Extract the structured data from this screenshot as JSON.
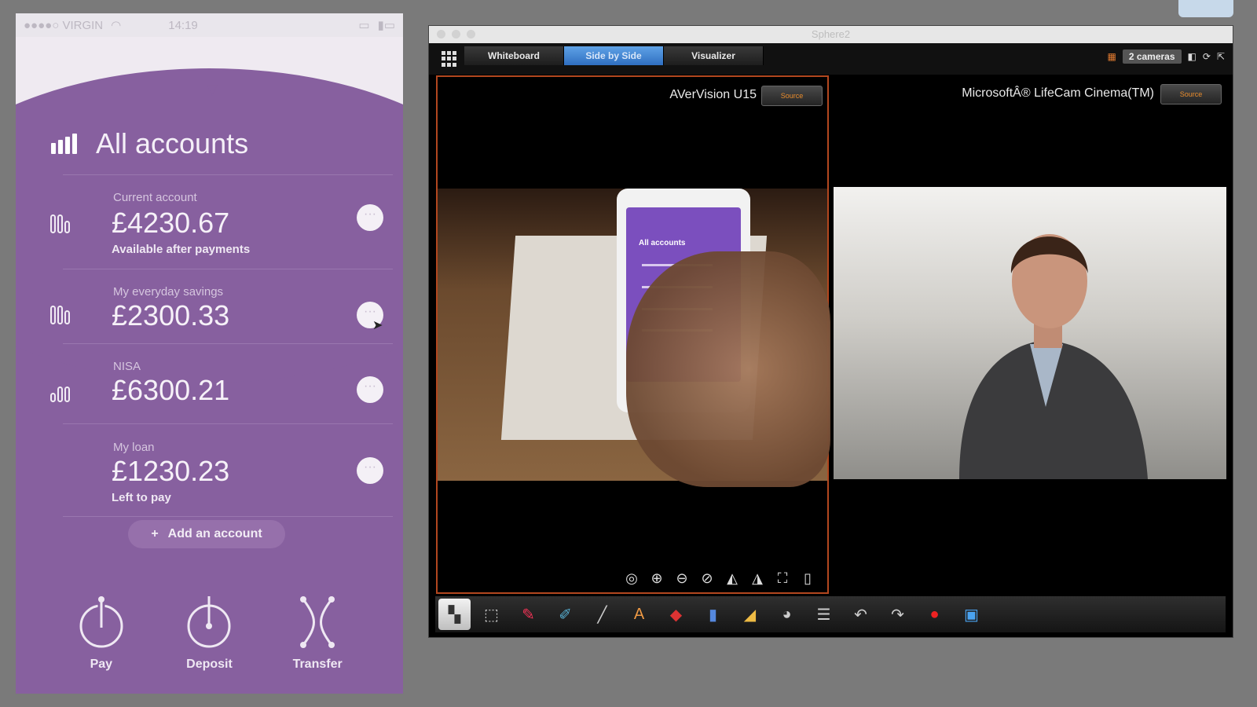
{
  "phone": {
    "status": {
      "carrier": "●●●●○ VIRGIN",
      "wifi": "wifi-icon",
      "time": "14:19"
    },
    "title": "All accounts",
    "accounts": [
      {
        "label": "Current account",
        "amount": "£4230.67",
        "note": "Available after payments"
      },
      {
        "label": "My everyday savings",
        "amount": "£2300.33",
        "note": ""
      },
      {
        "label": "NISA",
        "amount": "£6300.21",
        "note": ""
      },
      {
        "label": "My loan",
        "amount": "£1230.23",
        "note": "Left to pay"
      }
    ],
    "more": "···",
    "add_account": "Add an account",
    "add_plus": "+",
    "actions": [
      {
        "label": "Pay",
        "icon": "pay-icon"
      },
      {
        "label": "Deposit",
        "icon": "deposit-icon"
      },
      {
        "label": "Transfer",
        "icon": "transfer-icon"
      }
    ],
    "colors": {
      "primary": "#87609f",
      "header": "#efeaf1"
    }
  },
  "window": {
    "title": "Sphere2",
    "tabs": [
      "Whiteboard",
      "Side by Side",
      "Visualizer"
    ],
    "active_tab": "Side by Side",
    "cameras_label": "2 cameras",
    "left_camera": {
      "name": "AVerVision U15",
      "source_btn": "Source"
    },
    "right_camera": {
      "name": "MicrosoftÂ® LifeCam Cinema(TM)",
      "source_btn": "Source"
    },
    "mini_phone_title": "All accounts",
    "colors": {
      "active_tab": "#3f82d3",
      "selection_border": "#b2471f"
    }
  }
}
